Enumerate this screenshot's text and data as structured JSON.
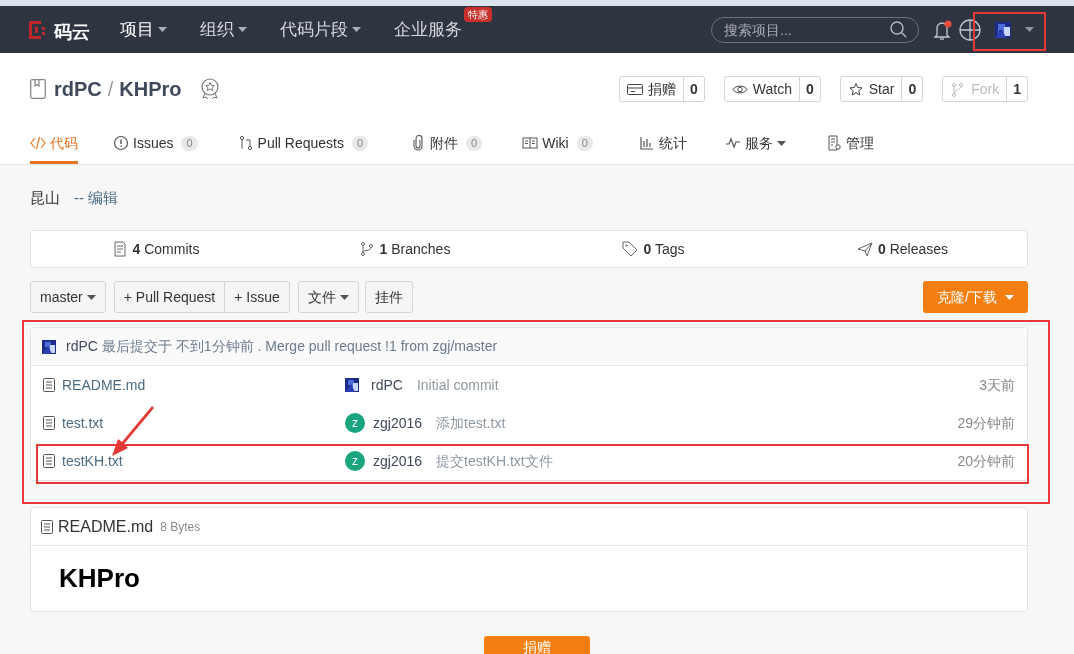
{
  "nav": {
    "logo": "码云",
    "menu": [
      {
        "label": "项目",
        "dropdown": true
      },
      {
        "label": "组织",
        "dropdown": true
      },
      {
        "label": "代码片段",
        "dropdown": true
      },
      {
        "label": "企业服务",
        "badge": "特惠"
      }
    ],
    "search": {
      "placeholder": "搜索项目..."
    },
    "notification_dot": true
  },
  "repo": {
    "owner": "rdPC",
    "separator": "/",
    "name": "KHPro",
    "actions": [
      {
        "label": "捐赠",
        "count": "0"
      },
      {
        "label": "Watch",
        "count": "0"
      },
      {
        "label": "Star",
        "count": "0"
      },
      {
        "label": "Fork",
        "count": "1",
        "disabled": true
      }
    ]
  },
  "tabs": [
    {
      "label": "代码",
      "selected": true
    },
    {
      "label": "Issues",
      "count": "0",
      "selected": false
    },
    {
      "label": "Pull Requests",
      "count": "0",
      "selected": false
    },
    {
      "label": "附件",
      "count": "0",
      "selected": false
    },
    {
      "label": "Wiki",
      "count": "0",
      "selected": false
    },
    {
      "label": "统计",
      "selected": false
    },
    {
      "label": "服务",
      "selected": false,
      "dropdown": true
    },
    {
      "label": "管理",
      "selected": false
    }
  ],
  "description": {
    "text": "昆山",
    "edit_link": "-- 编辑"
  },
  "stats": [
    {
      "count": "4",
      "label": "Commits"
    },
    {
      "count": "1",
      "label": "Branches"
    },
    {
      "count": "0",
      "label": "Tags"
    },
    {
      "count": "0",
      "label": "Releases"
    }
  ],
  "toolbar": {
    "branch": "master",
    "buttons": [
      {
        "label": "+ Pull Request",
        "kind": "plain"
      },
      {
        "label": "+ Issue",
        "kind": "plain"
      },
      {
        "label": "文件",
        "kind": "dropdown"
      },
      {
        "label": "挂件",
        "kind": "plain"
      }
    ],
    "clone": "克隆/下载"
  },
  "latest_commit": {
    "author": "rdPC",
    "text": "最后提交于 不到1分钟前 . Merge pull request !1 from zgj/master"
  },
  "files": [
    {
      "name": "README.md",
      "author": "rdPC",
      "message": "Initial commit",
      "time": "3天前"
    },
    {
      "name": "test.txt",
      "author": "zgj2016",
      "avatar": "z",
      "message": "添加test.txt",
      "time": "29分钟前"
    },
    {
      "name": "testKH.txt",
      "author": "zgj2016",
      "avatar": "z",
      "message": "提交testKH.txt文件",
      "time": "20分钟前"
    }
  ],
  "readme": {
    "file": "README.md",
    "size": "8 Bytes",
    "heading": "KHPro"
  },
  "donate": "捐赠"
}
